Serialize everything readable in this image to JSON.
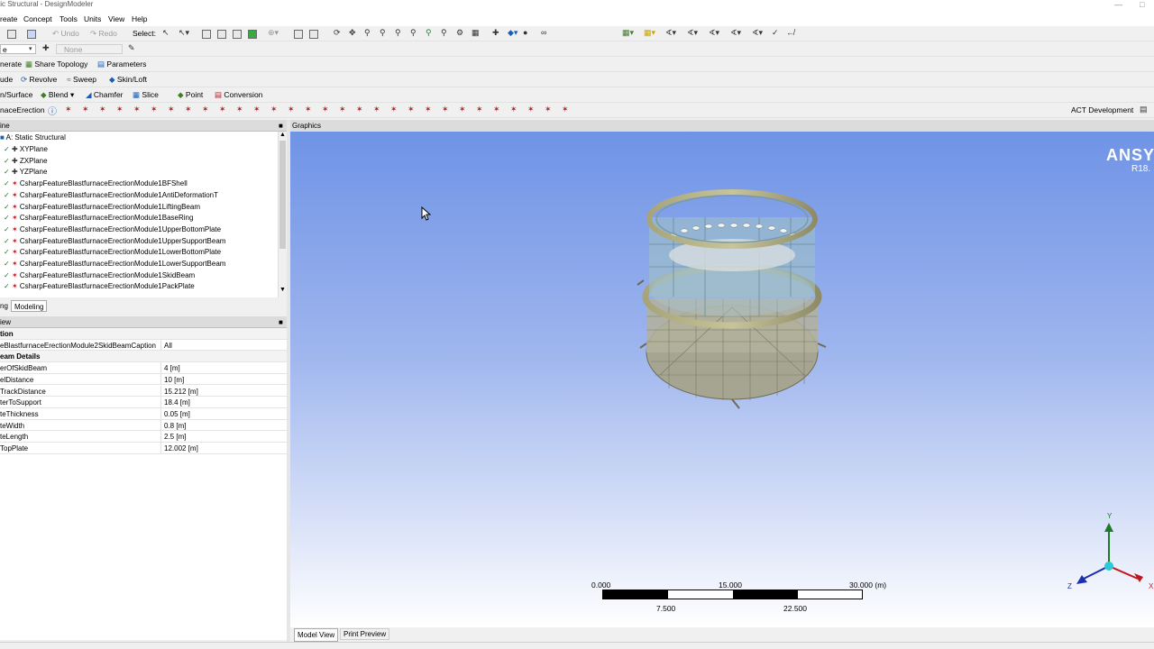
{
  "window": {
    "title": "tic Structural - DesignModeler"
  },
  "menu": [
    "reate",
    "Concept",
    "Tools",
    "Units",
    "View",
    "Help"
  ],
  "toolbar1": {
    "undo": "Undo",
    "redo": "Redo",
    "select": "Select:"
  },
  "toolbar2": {
    "plane": "e",
    "sketch": "None"
  },
  "toolbar3": {
    "generate": "nerate",
    "share_topology": "Share Topology",
    "parameters": "Parameters"
  },
  "toolbar4": {
    "extrude": "ude",
    "revolve": "Revolve",
    "sweep": "Sweep",
    "skin_loft": "Skin/Loft"
  },
  "toolbar5": {
    "thin": "n/Surface",
    "blend": "Blend",
    "chamfer": "Chamfer",
    "slice": "Slice",
    "point": "Point",
    "conversion": "Conversion"
  },
  "toolbar6": {
    "name": "naceErection",
    "act": "ACT Development"
  },
  "tree": {
    "header": "ine",
    "root": "A: Static Structural",
    "items": [
      "XYPlane",
      "ZXPlane",
      "YZPlane",
      "CsharpFeatureBlastfurnaceErectionModule1BFShell",
      "CsharpFeatureBlastfurnaceErectionModule1AntiDeformationT",
      "CsharpFeatureBlastfurnaceErectionModule1LiftingBeam",
      "CsharpFeatureBlastfurnaceErectionModule1BaseRing",
      "CsharpFeatureBlastfurnaceErectionModule1UpperBottomPlate",
      "CsharpFeatureBlastfurnaceErectionModule1UpperSupportBeam",
      "CsharpFeatureBlastfurnaceErectionModule1LowerBottomPlate",
      "CsharpFeatureBlastfurnaceErectionModule1LowerSupportBeam",
      "CsharpFeatureBlastfurnaceErectionModule1SkidBeam",
      "CsharpFeatureBlastfurnaceErectionModule1PackPlate"
    ]
  },
  "tabs": {
    "sketching": "ng",
    "modeling": "Modeling"
  },
  "details": {
    "header": "iew",
    "rows": [
      {
        "k": "tion",
        "v": "",
        "bold": true
      },
      {
        "k": "eBlastfurnaceErectionModule2SkidBeamCaption",
        "v": "All",
        "bold": false
      },
      {
        "k": "eam Details",
        "v": "",
        "bold": true
      },
      {
        "k": "erOfSkidBeam",
        "v": "4 [m]",
        "bold": false
      },
      {
        "k": "elDistance",
        "v": "10 [m]",
        "bold": false
      },
      {
        "k": "TrackDistance",
        "v": "15.212 [m]",
        "bold": false
      },
      {
        "k": "terToSupport",
        "v": "18.4 [m]",
        "bold": false
      },
      {
        "k": "teThickness",
        "v": "0.05 [m]",
        "bold": false
      },
      {
        "k": "teWidth",
        "v": "0.8 [m]",
        "bold": false
      },
      {
        "k": "teLength",
        "v": "2.5 [m]",
        "bold": false
      },
      {
        "k": "TopPlate",
        "v": "12.002 [m]",
        "bold": false
      }
    ]
  },
  "graphics": {
    "header": "Graphics",
    "brand": "ANSYS",
    "version": "R18.",
    "scale": {
      "t0": "0.000",
      "t1": "15.000",
      "t2": "30.000 (m)",
      "b1": "7.500",
      "b2": "22.500"
    },
    "axes": {
      "x": "X",
      "y": "Y",
      "z": "Z"
    }
  },
  "graphics_tabs": {
    "model_view": "Model View",
    "print_preview": "Print Preview"
  },
  "colors": {
    "accent": "#1a5fb4",
    "bg_top": "#6f93e6",
    "bg_bottom": "#ffffff"
  }
}
